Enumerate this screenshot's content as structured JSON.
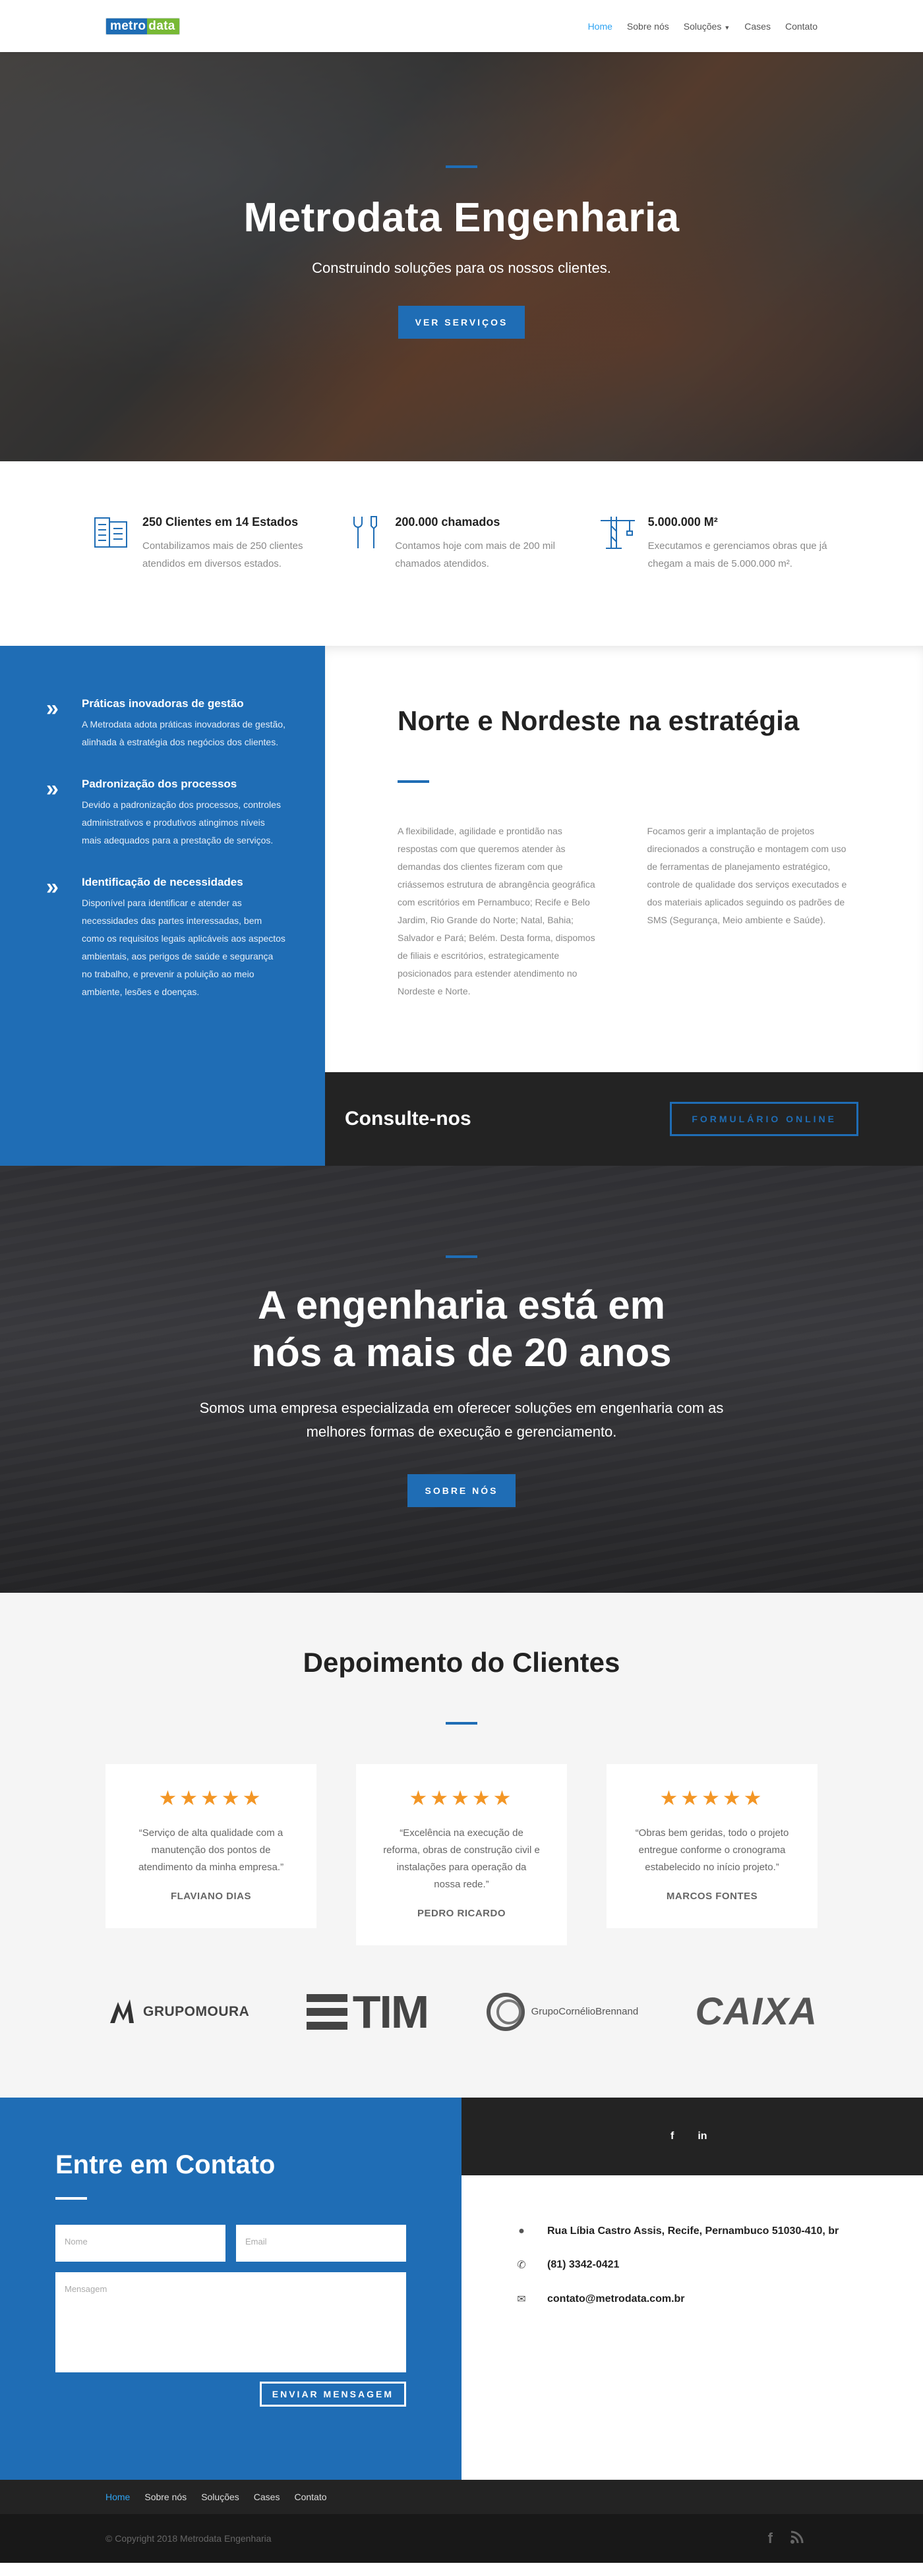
{
  "header": {
    "logo_part1": "metro",
    "logo_part2": "data",
    "nav": [
      {
        "label": "Home",
        "active": true
      },
      {
        "label": "Sobre nós"
      },
      {
        "label": "Soluções"
      },
      {
        "label": "Cases"
      },
      {
        "label": "Contato"
      }
    ]
  },
  "hero": {
    "title": "Metrodata Engenharia",
    "subtitle": "Construindo soluções para os nossos clientes.",
    "button": "VER SERVIÇOS"
  },
  "features": [
    {
      "icon": "document-icon",
      "title": "250 Clientes em 14 Estados",
      "text": "Contabilizamos mais de 250 clientes atendidos em diversos estados."
    },
    {
      "icon": "tools-icon",
      "title": "200.000 chamados",
      "text": "Contamos hoje com mais de 200 mil chamados atendidos."
    },
    {
      "icon": "crane-icon",
      "title": "5.000.000 M²",
      "text": "Executamos e gerenciamos  obras que já chegam a mais de 5.000.000 m²."
    }
  ],
  "strategy": {
    "items": [
      {
        "title": "Práticas inovadoras de gestão",
        "text": "A Metrodata adota práticas inovadoras de gestão, alinhada à estratégia dos negócios dos clientes."
      },
      {
        "title": "Padronização dos processos",
        "text": "Devido a padronização dos processos, controles administrativos e produtivos atingimos níveis mais adequados para a prestação de serviços."
      },
      {
        "title": "Identificação de necessidades",
        "text": "Disponível para identificar e atender as necessidades das partes interessadas, bem como os requisitos legais aplicáveis aos aspectos ambientais, aos perigos de saúde e segurança no trabalho, e prevenir a poluição ao meio ambiente, lesões e doenças."
      }
    ],
    "heading": "Norte e Nordeste na estratégia",
    "col1": "A flexibilidade, agilidade e prontidão nas respostas com que queremos atender às demandas dos clientes fizeram com que criássemos estrutura de abrangência geográfica com escritórios em Pernambuco; Recife e Belo Jardim, Rio Grande do Norte; Natal, Bahia; Salvador e Pará; Belém. Desta forma, dispomos de filiais e escritórios, estrategicamente posicionados para estender atendimento no Nordeste e Norte.",
    "col2": "Focamos gerir a implantação de projetos direcionados a construção e montagem com uso de ferramentas de planejamento estratégico, controle de qualidade dos serviços executados e dos materiais aplicados seguindo os padrões de SMS (Segurança, Meio ambiente e Saúde).",
    "consult_label": "Consulte-nos",
    "consult_button": "FORMULÁRIO ONLINE"
  },
  "years": {
    "title_line1": "A engenharia está em",
    "title_line2": "nós a mais de 20 anos",
    "text": "Somos uma empresa especializada em oferecer soluções em engenharia com as melhores formas de execução e gerenciamento.",
    "button": "SOBRE NÓS"
  },
  "testimonials": {
    "heading": "Depoimento do Clientes",
    "stars": "★★★★★",
    "items": [
      {
        "quote": "“Serviço de alta qualidade com a manutenção dos pontos de atendimento da minha empresa.”",
        "name": "FLAVIANO DIAS"
      },
      {
        "quote": "“Excelência na execução de reforma, obras de construção civil e instalações para operação da nossa rede.”",
        "name": "PEDRO RICARDO"
      },
      {
        "quote": "“Obras bem geridas, todo o projeto entregue conforme o cronograma estabelecido no início projeto.”",
        "name": "MARCOS FONTES"
      }
    ]
  },
  "logos": {
    "moura": "GRUPOMOURA",
    "tim": "TIM",
    "cb": "GrupoCornélioBrennand",
    "caixa": "CAIXA"
  },
  "contact": {
    "heading": "Entre em Contato",
    "name_placeholder": "Nome",
    "email_placeholder": "Email",
    "message_placeholder": "Mensagem",
    "send_button": "ENVIAR MENSAGEM",
    "social": [
      "f",
      "in"
    ],
    "address": "Rua Líbia Castro Assis, Recife, Pernambuco 51030-410, br",
    "phone": "(81) 3342-0421",
    "email": "contato@metrodata.com.br"
  },
  "footer": {
    "nav": [
      {
        "label": "Home",
        "active": true
      },
      {
        "label": "Sobre nós"
      },
      {
        "label": "Soluções"
      },
      {
        "label": "Cases"
      },
      {
        "label": "Contato"
      }
    ],
    "copyright": "© Copyright 2018 Metrodata Engenharia"
  }
}
